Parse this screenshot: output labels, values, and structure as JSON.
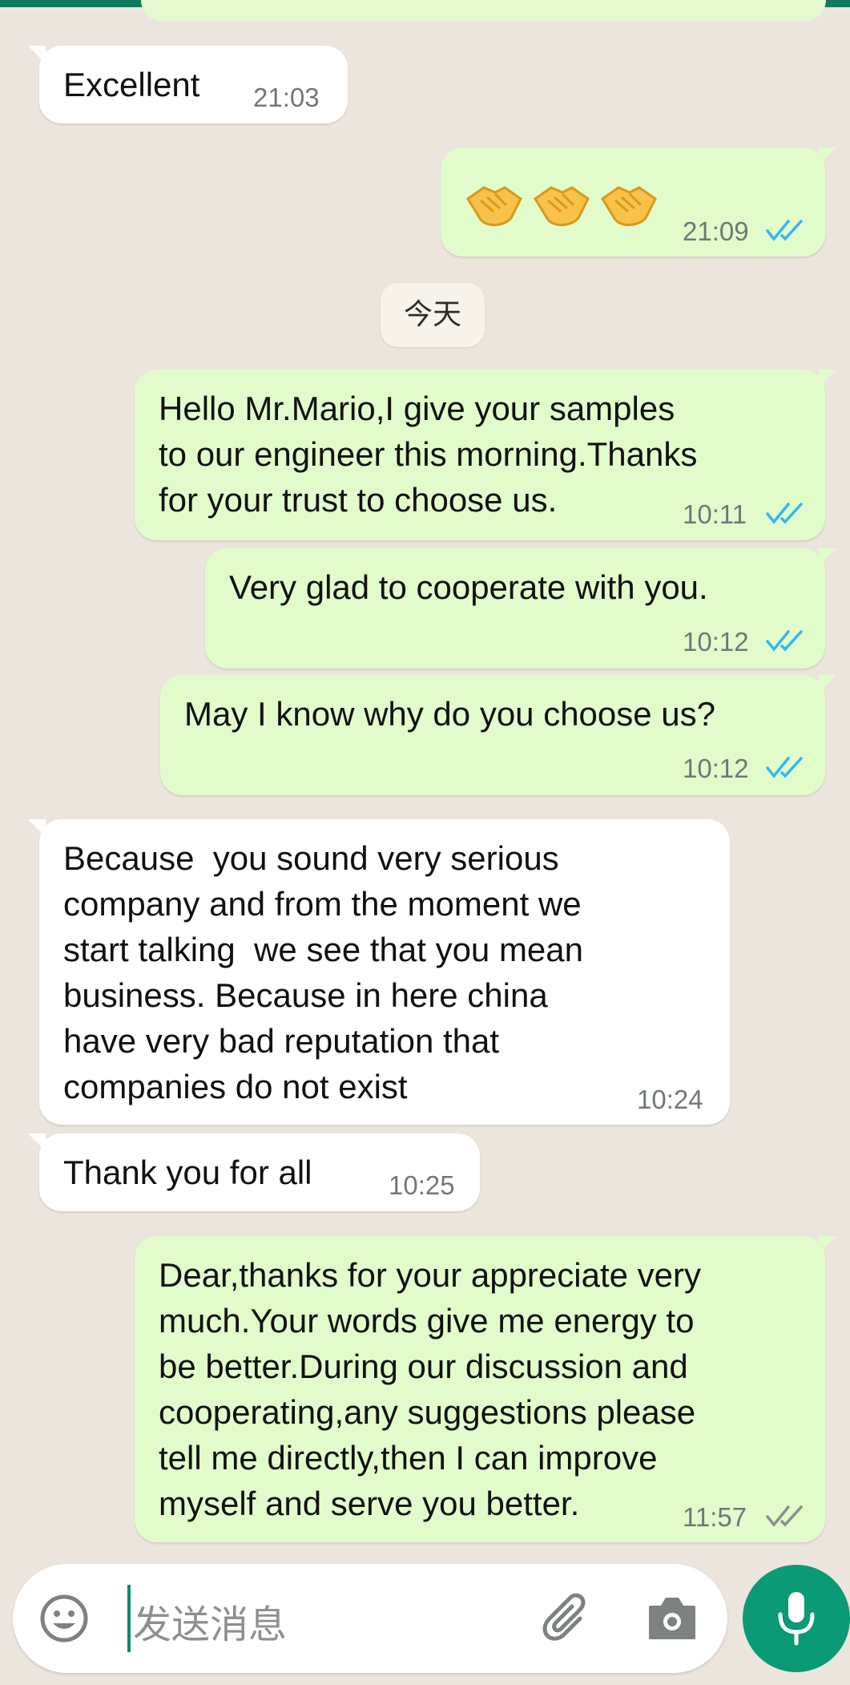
{
  "chat": {
    "date_separator": "今天",
    "messages": [
      {
        "direction": "in",
        "text": "Excellent",
        "time": "21:03"
      },
      {
        "direction": "out",
        "emoji": [
          "handshake-emoji",
          "handshake-emoji",
          "handshake-emoji"
        ],
        "time": "21:09",
        "status": "read"
      },
      {
        "direction": "out",
        "lines": [
          "Hello Mr.Mario,I give your samples",
          "to our engineer this morning.Thanks",
          "for your trust to choose us."
        ],
        "time": "10:11",
        "status": "read"
      },
      {
        "direction": "out",
        "text": "Very glad to cooperate with you.",
        "time": "10:12",
        "status": "read"
      },
      {
        "direction": "out",
        "text": "May I know why do you choose us?",
        "time": "10:12",
        "status": "read"
      },
      {
        "direction": "in",
        "lines": [
          "Because  you sound very serious",
          "company and from the moment we",
          "start talking  we see that you mean",
          "business. Because in here china",
          "have very bad reputation that",
          "companies do not exist"
        ],
        "time": "10:24"
      },
      {
        "direction": "in",
        "text": "Thank you for all",
        "time": "10:25"
      },
      {
        "direction": "out",
        "lines": [
          "Dear,thanks for your appreciate very",
          "much.Your words give me energy to",
          "be better.During our discussion and",
          "cooperating,any suggestions please",
          "tell me directly,then I can improve",
          "myself and serve you better."
        ],
        "time": "11:57",
        "status": "delivered"
      }
    ]
  },
  "composer": {
    "placeholder": "发送消息",
    "icons": [
      "emoji-icon",
      "attach-icon",
      "camera-icon",
      "mic-icon"
    ]
  },
  "colors": {
    "header_accent": "#0f7a5e",
    "incoming_bubble": "#ffffff",
    "outgoing_bubble": "#e2fbcb",
    "read_tick": "#34b7f1",
    "delivered_tick": "#8a8f8c",
    "mic_button": "#0a9a75"
  }
}
